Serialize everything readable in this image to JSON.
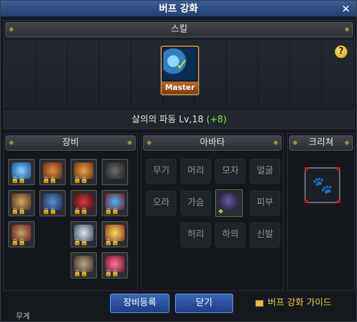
{
  "window": {
    "title": "버프 강화",
    "close": "✕"
  },
  "skill": {
    "header": "스킬",
    "badge": "Master",
    "name": "살의의 파동 Lv,18",
    "bonus": "(+8)",
    "help": "?"
  },
  "equip": {
    "header": "장비"
  },
  "avatar": {
    "header": "아바타",
    "slots": [
      "무기",
      "머리",
      "모자",
      "얼굴",
      "오라",
      "가슴",
      "피부",
      "허리",
      "하의",
      "신발"
    ]
  },
  "creature": {
    "header": "크리쳐"
  },
  "buttons": {
    "register": "장비등록",
    "close": "닫기"
  },
  "guide": {
    "label": "버프 강화 가이드"
  },
  "footer": {
    "label": "무게"
  },
  "colors": {
    "title_bar": "#2e4f85",
    "button": "#2a56a8",
    "bonus_green": "#7fe65a",
    "guide_yellow": "#f0d13f"
  }
}
